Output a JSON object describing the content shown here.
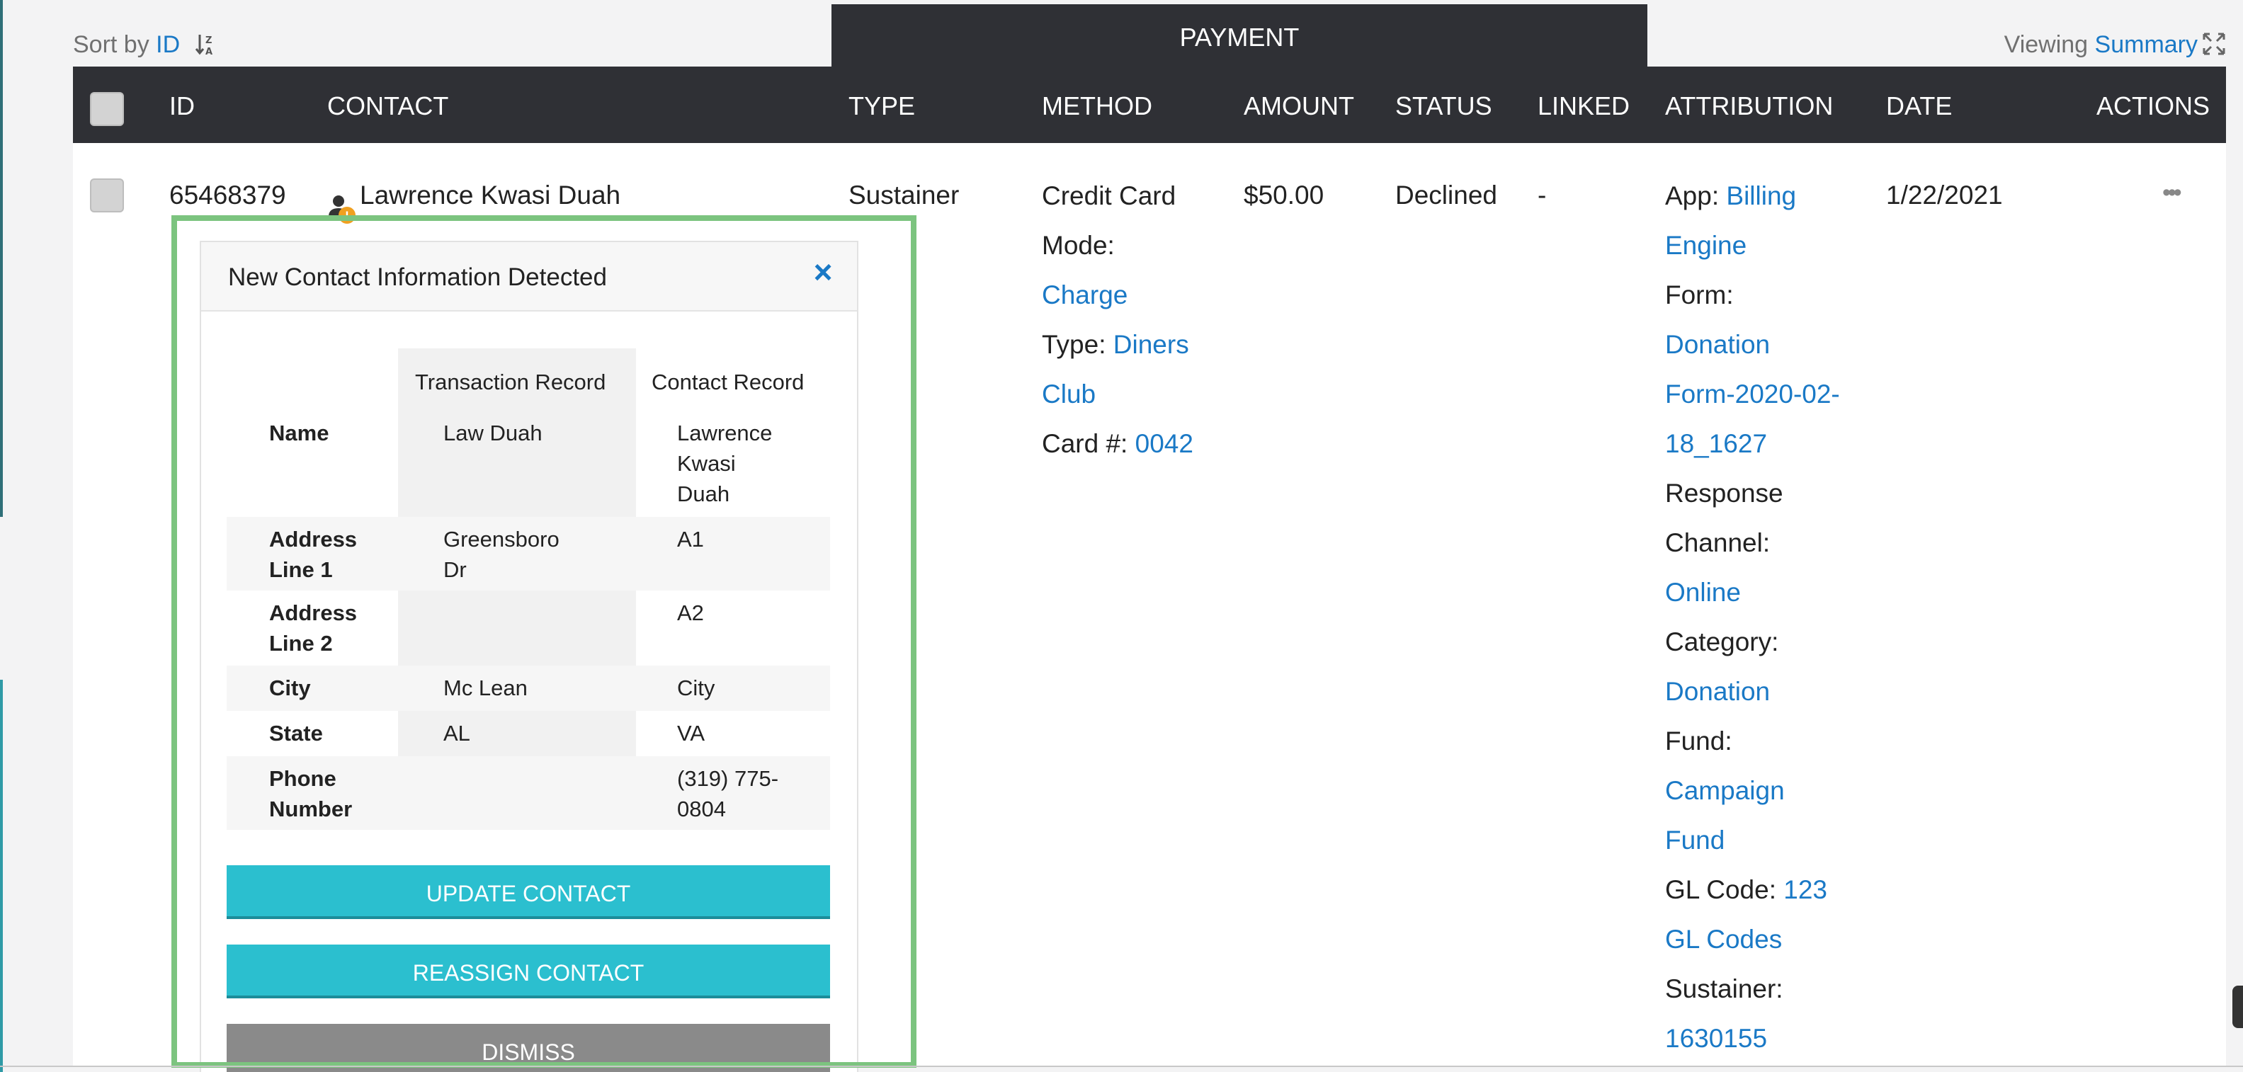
{
  "top": {
    "sort_label": "Sort by",
    "sort_value": "ID",
    "payment_header": "PAYMENT",
    "viewing_label": "Viewing",
    "viewing_value": "Summary"
  },
  "table": {
    "columns": [
      "ID",
      "CONTACT",
      "TYPE",
      "METHOD",
      "AMOUNT",
      "STATUS",
      "LINKED",
      "ATTRIBUTION",
      "DATE",
      "ACTIONS"
    ],
    "row": {
      "id": "65468379",
      "contact": "Lawrence Kwasi Duah",
      "type": "Sustainer",
      "method": {
        "line1": "Credit Card",
        "mode_label": "Mode:",
        "mode_value": "Charge",
        "type_label": "Type:",
        "type_value_1": "Diners",
        "type_value_2": "Club",
        "card_label": "Card #:",
        "card_value": "0042"
      },
      "amount": "$50.00",
      "status": "Declined",
      "linked": "-",
      "attribution": {
        "app_label": "App:",
        "app_value_1": "Billing",
        "app_value_2": "Engine",
        "form_label": "Form:",
        "form_value_1": "Donation",
        "form_value_2": "Form-2020-02-",
        "form_value_3": "18_1627",
        "response_label_1": "Response",
        "response_label_2": "Channel:",
        "response_value": "Online",
        "category_label": "Category:",
        "category_value": "Donation",
        "fund_label": "Fund:",
        "fund_value_1": "Campaign",
        "fund_value_2": "Fund",
        "gl_label": "GL Code:",
        "gl_value_1": "123",
        "gl_value_2": "GL Codes",
        "sustainer_label": "Sustainer:",
        "sustainer_value": "1630155"
      },
      "date": "1/22/2021",
      "actions": "•••"
    }
  },
  "popup": {
    "title": "New Contact Information Detected",
    "close": "×",
    "col_transaction": "Transaction Record",
    "col_contact": "Contact Record",
    "rows": [
      {
        "label": "Name",
        "transaction": "Law Duah",
        "contact": "Lawrence Kwasi Duah"
      },
      {
        "label": "Address Line 1",
        "transaction": "Greensboro Dr",
        "contact": "A1"
      },
      {
        "label": "Address Line 2",
        "transaction": "",
        "contact": "A2"
      },
      {
        "label": "City",
        "transaction": "Mc Lean",
        "contact": "City"
      },
      {
        "label": "State",
        "transaction": "AL",
        "contact": "VA"
      },
      {
        "label": "Phone Number",
        "transaction": "",
        "contact": "(319) 775-0804"
      }
    ],
    "btn_update": "UPDATE CONTACT",
    "btn_reassign": "REASSIGN CONTACT",
    "btn_dismiss": "DISMISS"
  },
  "colors": {
    "header_bg": "#2f3035",
    "link": "#1a79c6",
    "teal_button": "#2bbfcf",
    "gray_button": "#8a8a8a",
    "highlight_outline": "#7cc47f",
    "badge": "#f0a020"
  }
}
